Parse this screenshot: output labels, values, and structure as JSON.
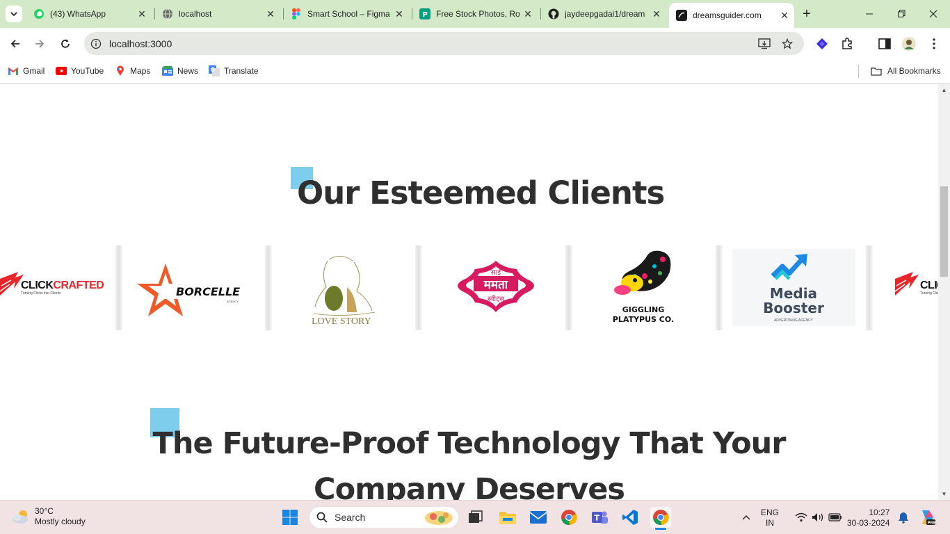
{
  "browser": {
    "tabs": [
      {
        "title": "(43) WhatsApp",
        "icon": "whatsapp-icon",
        "active": false
      },
      {
        "title": "localhost",
        "icon": "globe-icon",
        "active": false
      },
      {
        "title": "Smart School – Figma",
        "icon": "figma-icon",
        "active": false
      },
      {
        "title": "Free Stock Photos, Ro",
        "icon": "pexels-icon",
        "active": false
      },
      {
        "title": "jaydeepgadai1/dream",
        "icon": "github-icon",
        "active": false
      },
      {
        "title": "dreamsguider.com",
        "icon": "site-icon",
        "active": true
      }
    ],
    "new_tab": "+",
    "close_glyph": "✕",
    "address": "localhost:3000",
    "bookmarks": [
      {
        "label": "Gmail",
        "icon": "gmail-icon"
      },
      {
        "label": "YouTube",
        "icon": "youtube-icon"
      },
      {
        "label": "Maps",
        "icon": "maps-icon"
      },
      {
        "label": "News",
        "icon": "news-icon"
      },
      {
        "label": "Translate",
        "icon": "translate-icon"
      }
    ],
    "all_bookmarks": "All Bookmarks"
  },
  "page": {
    "clients_heading": "Our Esteemed Clients",
    "tech_heading_line1": "The Future-Proof Technology That Your",
    "tech_heading_line2": "Company Deserves",
    "logos": {
      "clickcrafted": {
        "name": "CLICKCRAFTED",
        "part1": "CLICK",
        "part2": "CRAFTED",
        "tagline": "Turning Clicks into Clients"
      },
      "borcelle": {
        "name": "BORCELLE",
        "sub": "AGENCY"
      },
      "lovestory": {
        "name": "LOVE STORY"
      },
      "mamta": {
        "top": "साई",
        "main": "ममता",
        "sub": "स्वीट्स"
      },
      "platypus": {
        "line1": "GIGGLING",
        "line2": "PLATYPUS CO."
      },
      "mediabooster": {
        "line1": "Media",
        "line2": "Booster",
        "sub": "ADVERTISING AGENCY"
      }
    },
    "accent_color": "#7fcdec",
    "heading_color": "#2f2f2f"
  },
  "taskbar": {
    "weather_temp": "30°C",
    "weather_desc": "Mostly cloudy",
    "search_label": "Search",
    "lang_line1": "ENG",
    "lang_line2": "IN",
    "time": "10:27",
    "date": "30-03-2024"
  }
}
